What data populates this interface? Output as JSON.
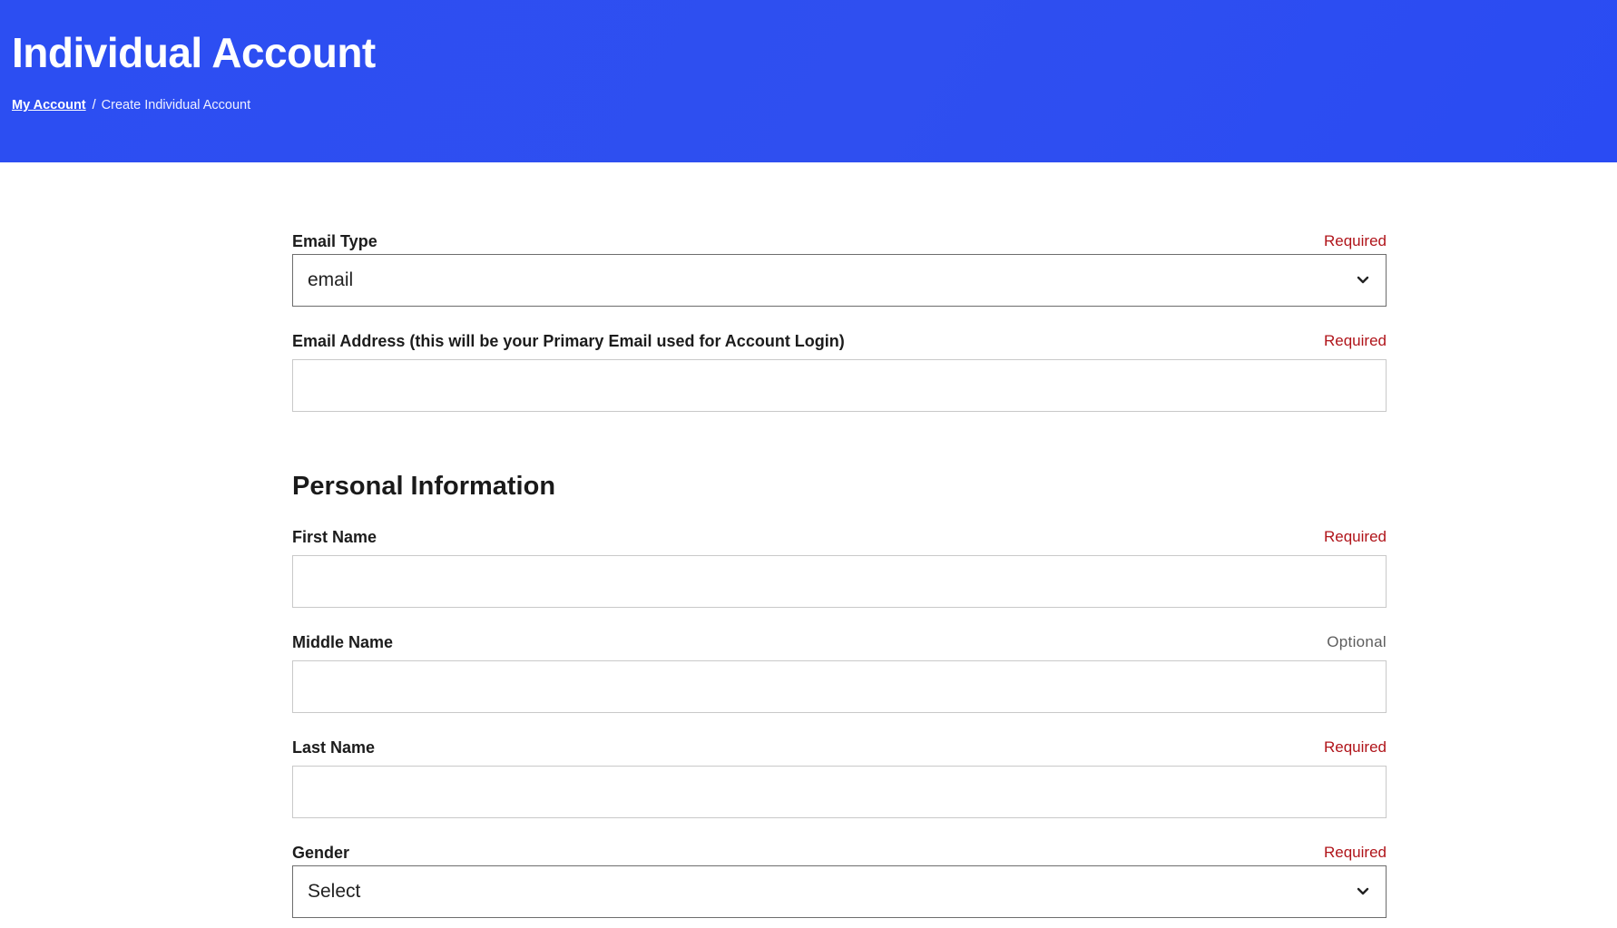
{
  "header": {
    "title": "Individual Account",
    "breadcrumb": {
      "link": "My Account",
      "separator": "/",
      "current": "Create Individual Account"
    }
  },
  "form": {
    "email_type": {
      "label": "Email Type",
      "status": "Required",
      "value": "email"
    },
    "email_address": {
      "label": "Email Address (this will be your Primary Email used for Account Login)",
      "status": "Required",
      "value": ""
    },
    "personal_section_title": "Personal Information",
    "first_name": {
      "label": "First Name",
      "status": "Required",
      "value": ""
    },
    "middle_name": {
      "label": "Middle Name",
      "status": "Optional",
      "value": ""
    },
    "last_name": {
      "label": "Last Name",
      "status": "Required",
      "value": ""
    },
    "gender": {
      "label": "Gender",
      "status": "Required",
      "value": "Select"
    }
  },
  "colors": {
    "header_bg": "#2c4ef2",
    "required": "#b0141a",
    "optional": "#5d5d5d"
  },
  "icons": {
    "select_arrow": "chevron-down-icon"
  }
}
